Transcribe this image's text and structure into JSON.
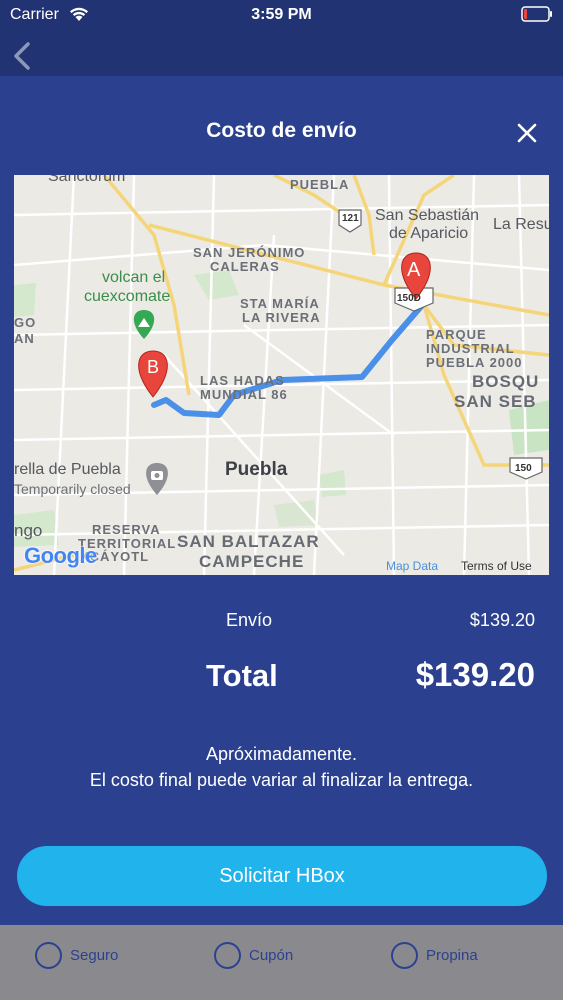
{
  "status_bar": {
    "carrier": "Carrier",
    "time": "3:59 PM"
  },
  "nav": {
    "back_icon": "chevron-left-icon"
  },
  "modal": {
    "title": "Costo de envío",
    "close_icon": "close-icon",
    "map": {
      "labels": {
        "sanctorum": "Sanctorum",
        "puebla_road": "PUEBLA",
        "san_sebastian": "San Sebastián",
        "de_aparicio": "de Aparicio",
        "la_resu": "La Resu",
        "san_jeronimo": "SAN JERÓNIMO",
        "caleras": "CALERAS",
        "volcan_1": "volcan el",
        "volcan_2": "cuexcomate",
        "sta_maria": "STA MARÍA",
        "la_rivera": "LA RIVERA",
        "parque": "PARQUE",
        "industrial": "INDUSTRIAL",
        "puebla_2000": "PUEBLA 2000",
        "bosque": "BOSQU",
        "san_seb": "SAN SEB",
        "las_hadas": "LAS HADAS",
        "mundial": "MUNDIAL 86",
        "go": "GO",
        "an": "AN",
        "rella": "rella de Puebla",
        "temp_closed": "Temporarily closed",
        "puebla_city": "Puebla",
        "ngo": "ngo",
        "reserva": "RESERVA",
        "territorial": "TERRITORIAL",
        "xcayotl": "XCÁYOTL",
        "san_baltazar": "SAN BALTAZAR",
        "campeche": "CAMPECHE"
      },
      "shields": {
        "r121": "121",
        "r150d": "150D",
        "r150": "150"
      },
      "markers": {
        "origin": "A",
        "destination": "B"
      },
      "google": "Google",
      "map_data": "Map Data",
      "terms": "Terms of Use"
    },
    "fee_label": "Envío",
    "fee_value": "$139.20",
    "total_label": "Total",
    "total_value": "$139.20",
    "note_line1": "Apróximadamente.",
    "note_line2": "El costo final puede variar al finalizar la entrega.",
    "request_button": "Solicitar HBox"
  },
  "bottom_options": [
    {
      "label": "Seguro"
    },
    {
      "label": "Cupón"
    },
    {
      "label": "Propina"
    }
  ],
  "colors": {
    "background": "#2b4190",
    "nav": "#213372",
    "accent": "#21b3eb",
    "route": "#4a8fe8",
    "marker": "#e8453c"
  }
}
